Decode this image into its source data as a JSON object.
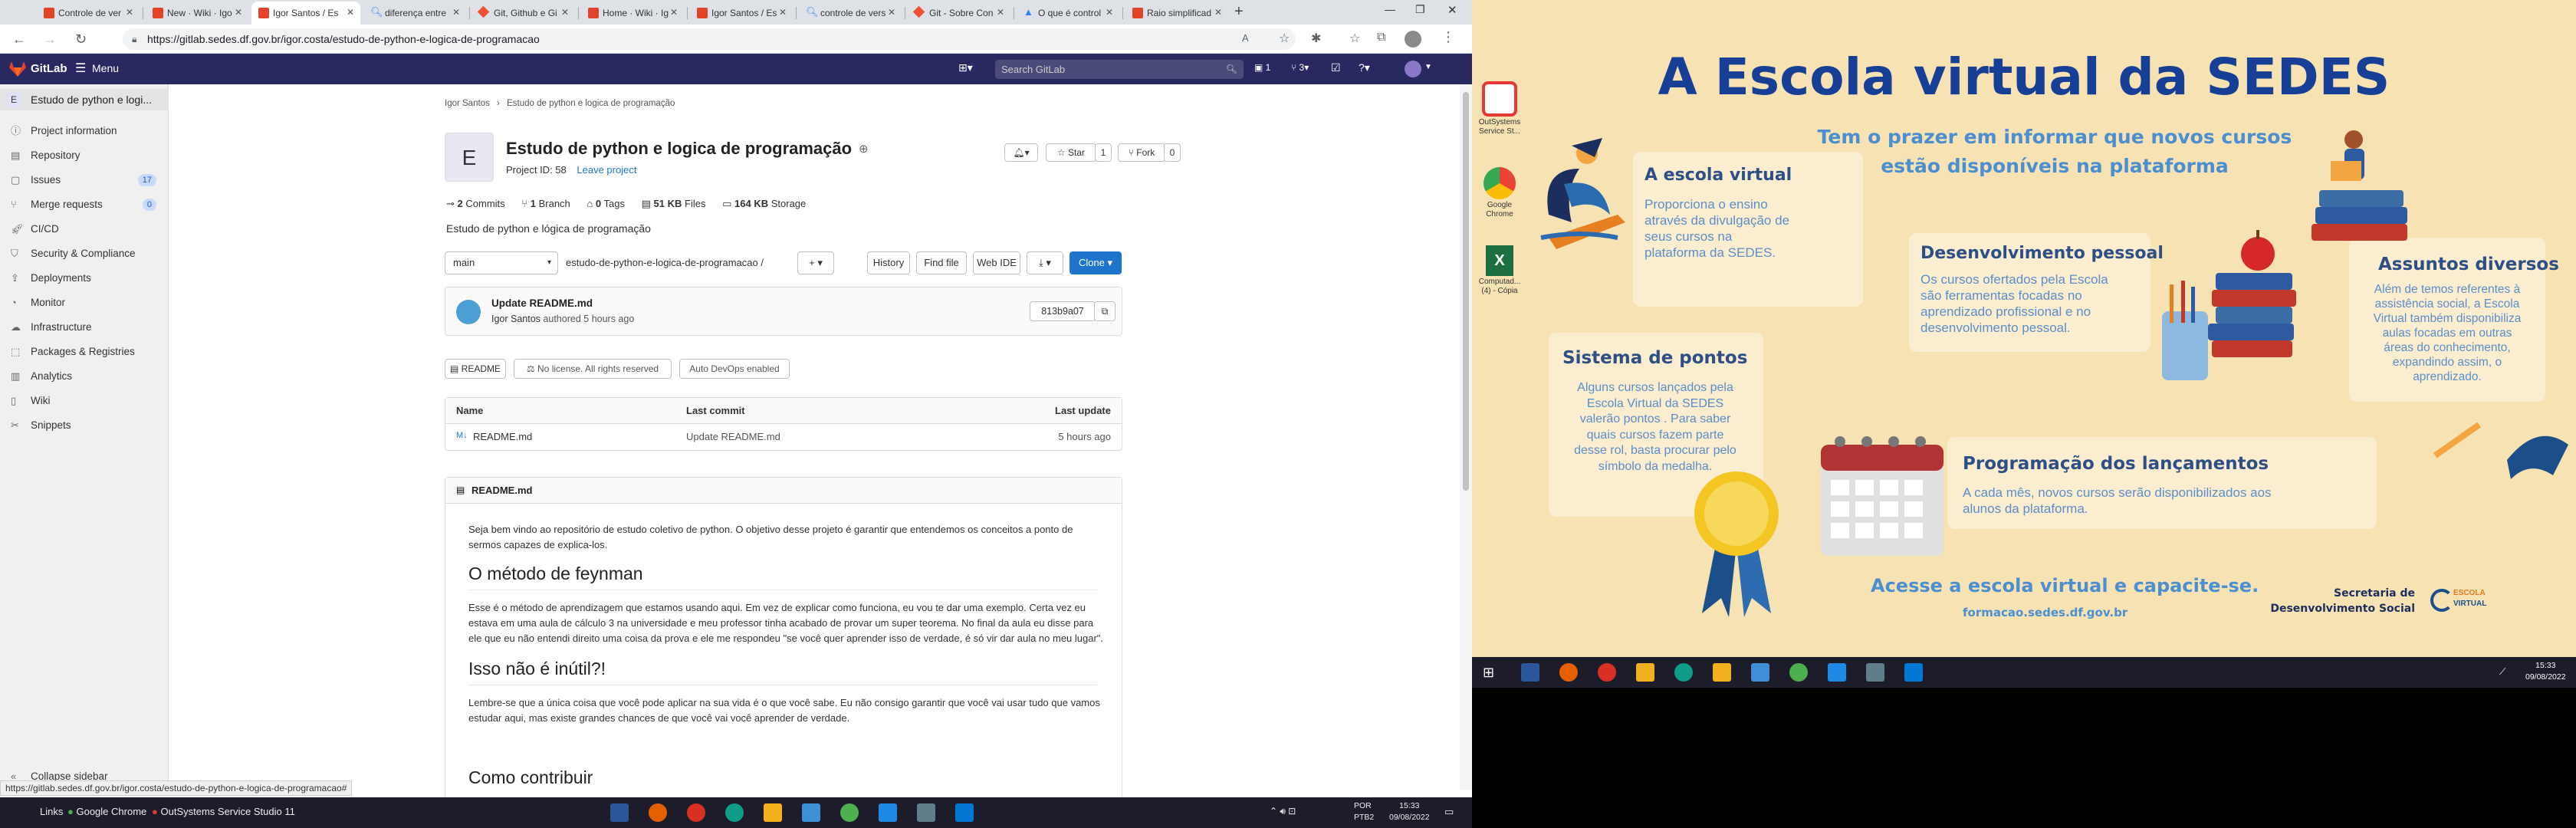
{
  "browser": {
    "tabs": [
      {
        "label": "Controle de ver"
      },
      {
        "label": "New · Wiki · Igo"
      },
      {
        "label": "Igor Santos / Es"
      },
      {
        "label": "diferença entre"
      },
      {
        "label": "Git, Github e Gi"
      },
      {
        "label": "Home · Wiki · Ig"
      },
      {
        "label": "Igor Santos / Es"
      },
      {
        "label": "controle de vers"
      },
      {
        "label": "Git - Sobre Con"
      },
      {
        "label": "O que é control"
      },
      {
        "label": "Raio simplificad"
      }
    ],
    "url": "https://gitlab.sedes.df.gov.br/igor.costa/estudo-de-python-e-logica-de-programacao"
  },
  "gitlab": {
    "brand": "GitLab",
    "menu": "Menu",
    "search_placeholder": "Search GitLab",
    "header_counts": [
      "1",
      "3"
    ],
    "sidebar": {
      "project_initial": "E",
      "project_name": "Estudo de python e logi...",
      "items": [
        {
          "label": "Project information",
          "icon": "info-icon",
          "badge": ""
        },
        {
          "label": "Repository",
          "icon": "repository-icon",
          "badge": ""
        },
        {
          "label": "Issues",
          "icon": "issues-icon",
          "badge": "17"
        },
        {
          "label": "Merge requests",
          "icon": "merge-request-icon",
          "badge": "0"
        },
        {
          "label": "CI/CD",
          "icon": "rocket-icon",
          "badge": ""
        },
        {
          "label": "Security & Compliance",
          "icon": "shield-icon",
          "badge": ""
        },
        {
          "label": "Deployments",
          "icon": "deployments-icon",
          "badge": ""
        },
        {
          "label": "Monitor",
          "icon": "monitor-icon",
          "badge": ""
        },
        {
          "label": "Infrastructure",
          "icon": "cloud-icon",
          "badge": ""
        },
        {
          "label": "Packages & Registries",
          "icon": "package-icon",
          "badge": ""
        },
        {
          "label": "Analytics",
          "icon": "chart-icon",
          "badge": ""
        },
        {
          "label": "Wiki",
          "icon": "book-icon",
          "badge": ""
        },
        {
          "label": "Snippets",
          "icon": "snippet-icon",
          "badge": ""
        }
      ],
      "collapse": "Collapse sidebar"
    },
    "breadcrumb": [
      "Igor Santos",
      "Estudo de python e logica de programação"
    ],
    "project": {
      "avatar": "E",
      "title": "Estudo de python e logica de programação",
      "id_text": "Project ID: 58",
      "leave": "Leave project",
      "star": "Star",
      "star_count": "1",
      "fork": "Fork",
      "fork_count": "0",
      "stats": [
        {
          "num": "2",
          "label": "Commits"
        },
        {
          "num": "1",
          "label": "Branch"
        },
        {
          "num": "0",
          "label": "Tags"
        },
        {
          "num": "51 KB",
          "label": "Files"
        },
        {
          "num": "164 KB",
          "label": "Storage"
        }
      ],
      "description": "Estudo de python e lógica de programação"
    },
    "toolbar": {
      "branch": "main",
      "path": "estudo-de-python-e-logica-de-programacao",
      "history": "History",
      "find": "Find file",
      "webide": "Web IDE",
      "clone": "Clone"
    },
    "commit": {
      "title": "Update README.md",
      "author": "Igor Santos",
      "authored": "authored",
      "time": "5 hours ago",
      "sha": "813b9a07"
    },
    "badges": [
      "README",
      "No license. All rights reserved",
      "Auto DevOps enabled"
    ],
    "table": {
      "headers": [
        "Name",
        "Last commit",
        "Last update"
      ],
      "rows": [
        {
          "name": "README.md",
          "commit": "Update README.md",
          "update": "5 hours ago"
        }
      ]
    },
    "readme": {
      "title": "README.md",
      "p1": "Seja bem vindo ao repositório de estudo coletivo de python. O objetivo desse projeto é garantir que entendemos os conceitos a ponto de sermos capazes de explica-los.",
      "h1": "O método de feynman",
      "p2": "Esse é o método de aprendizagem que estamos usando aqui. Em vez de explicar como funciona, eu vou te dar uma exemplo. Certa vez eu estava em uma aula de cálculo 3 na universidade e meu professor tinha acabado de provar um super teorema. No final da aula eu disse para ele que eu não entendi direito uma coisa da prova e ele me respondeu \"se você quer aprender isso de verdade, é só vir dar aula no meu lugar\".",
      "h2": "Isso não é inútil?!",
      "p3": "Lembre-se que a única coisa que você pode aplicar na sua vida é o que você sabe. Eu não consigo garantir que você vai usar tudo que vamos estudar aqui, mas existe grandes chances de que você vai você aprender de verdade.",
      "h3": "Como contribuir"
    },
    "status_url": "https://gitlab.sedes.df.gov.br/igor.costa/estudo-de-python-e-logica-de-programacao#"
  },
  "taskbar_left": {
    "links": "Links",
    "chrome": "Google Chrome",
    "outsystems": "OutSystems Service Studio 11",
    "lang": "POR",
    "kb": "PTB2",
    "time": "15:33",
    "date": "09/08/2022"
  },
  "poster": {
    "title": "A Escola virtual da SEDES",
    "subtitle1": "Tem o prazer em informar que novos cursos",
    "subtitle2": "estão disponíveis na plataforma",
    "desktop_icons": [
      "OutSystems Service St...",
      "Google Chrome",
      "Computad... (4) - Cópia"
    ],
    "cards": [
      {
        "title": "A escola virtual",
        "text": [
          "Proporciona o ensino",
          "através da divulgação de",
          "seus cursos na",
          "plataforma da SEDES."
        ]
      },
      {
        "title": "Desenvolvimento pessoal",
        "text": [
          "Os cursos ofertados pela Escola",
          "são ferramentas focadas no",
          "aprendizado profissional  e no",
          "desenvolvimento pessoal."
        ]
      },
      {
        "title": "Assuntos diversos",
        "text": [
          "Além de temos referentes à",
          "assistência social, a Escola",
          "Virtual também disponibiliza",
          "aulas focadas em outras",
          "áreas do conhecimento,",
          "expandindo assim, o",
          "aprendizado."
        ]
      },
      {
        "title": "Sistema de pontos",
        "text": [
          "Alguns cursos lançados pela",
          "Escola Virtual da SEDES",
          "valerão pontos . Para saber",
          "quais cursos fazem parte",
          "desse rol, basta procurar pelo",
          "símbolo da medalha."
        ]
      },
      {
        "title": "Programação dos lançamentos",
        "text": [
          "A cada mês, novos cursos serão disponibilizados aos",
          "alunos da plataforma."
        ]
      }
    ],
    "footer_cta": "Acesse a escola virtual e capacite-se.",
    "footer_url": "formacao.sedes.df.gov.br",
    "org1": "Secretaria de",
    "org2": "Desenvolvimento Social",
    "logo_text1": "ESCOLA",
    "logo_text2": "VIRTUAL",
    "colors": {
      "title": "#173f95",
      "subtitle": "#4b8fd1",
      "background": "#f7e2b4"
    }
  },
  "taskbar_right": {
    "time": "15:33",
    "date": "09/08/2022"
  }
}
